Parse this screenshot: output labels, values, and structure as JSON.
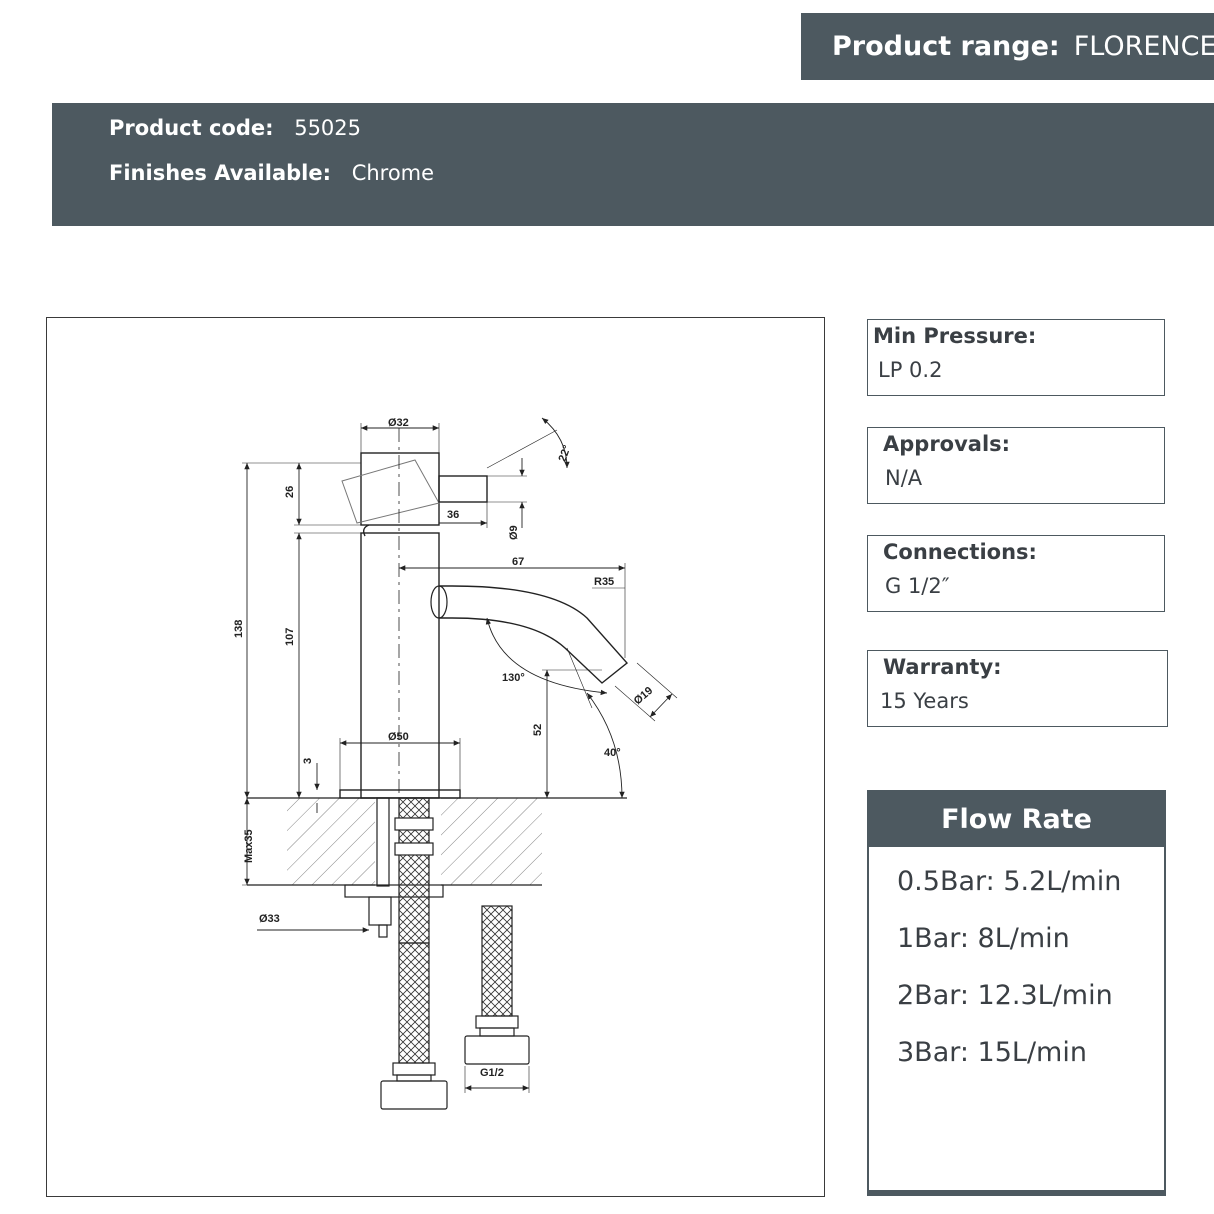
{
  "header": {
    "range_label": "Product range:",
    "range_value": "FLORENCE",
    "code_label": "Product code:",
    "code_value": "55025",
    "finish_label": "Finishes Available:",
    "finish_value": "Chrome"
  },
  "specs": [
    {
      "title": "Min Pressure:",
      "value": "LP 0.2"
    },
    {
      "title": "Approvals:",
      "value": "N/A"
    },
    {
      "title": "Connections:",
      "value": "G 1/2″"
    },
    {
      "title": "Warranty:",
      "value": "15 Years"
    }
  ],
  "flow_rate": {
    "title": "Flow Rate",
    "rows": [
      "0.5Bar: 5.2L/min",
      "1Bar: 8L/min",
      "2Bar: 12.3L/min",
      "3Bar: 15L/min"
    ]
  },
  "drawing": {
    "dims": {
      "d32": "Ø32",
      "a22": "22°",
      "h26": "26",
      "l36": "36",
      "d9": "Ø9",
      "l67": "67",
      "r35": "R35",
      "h138": "138",
      "h107": "107",
      "a130": "130°",
      "d19": "Ø19",
      "h52": "52",
      "a40": "40°",
      "d50": "Ø50",
      "h3": "3",
      "max35": "Max35",
      "d33": "Ø33",
      "g12": "G1/2"
    }
  },
  "colors": {
    "panel": "#4d5960",
    "text": "#3a3f44"
  }
}
